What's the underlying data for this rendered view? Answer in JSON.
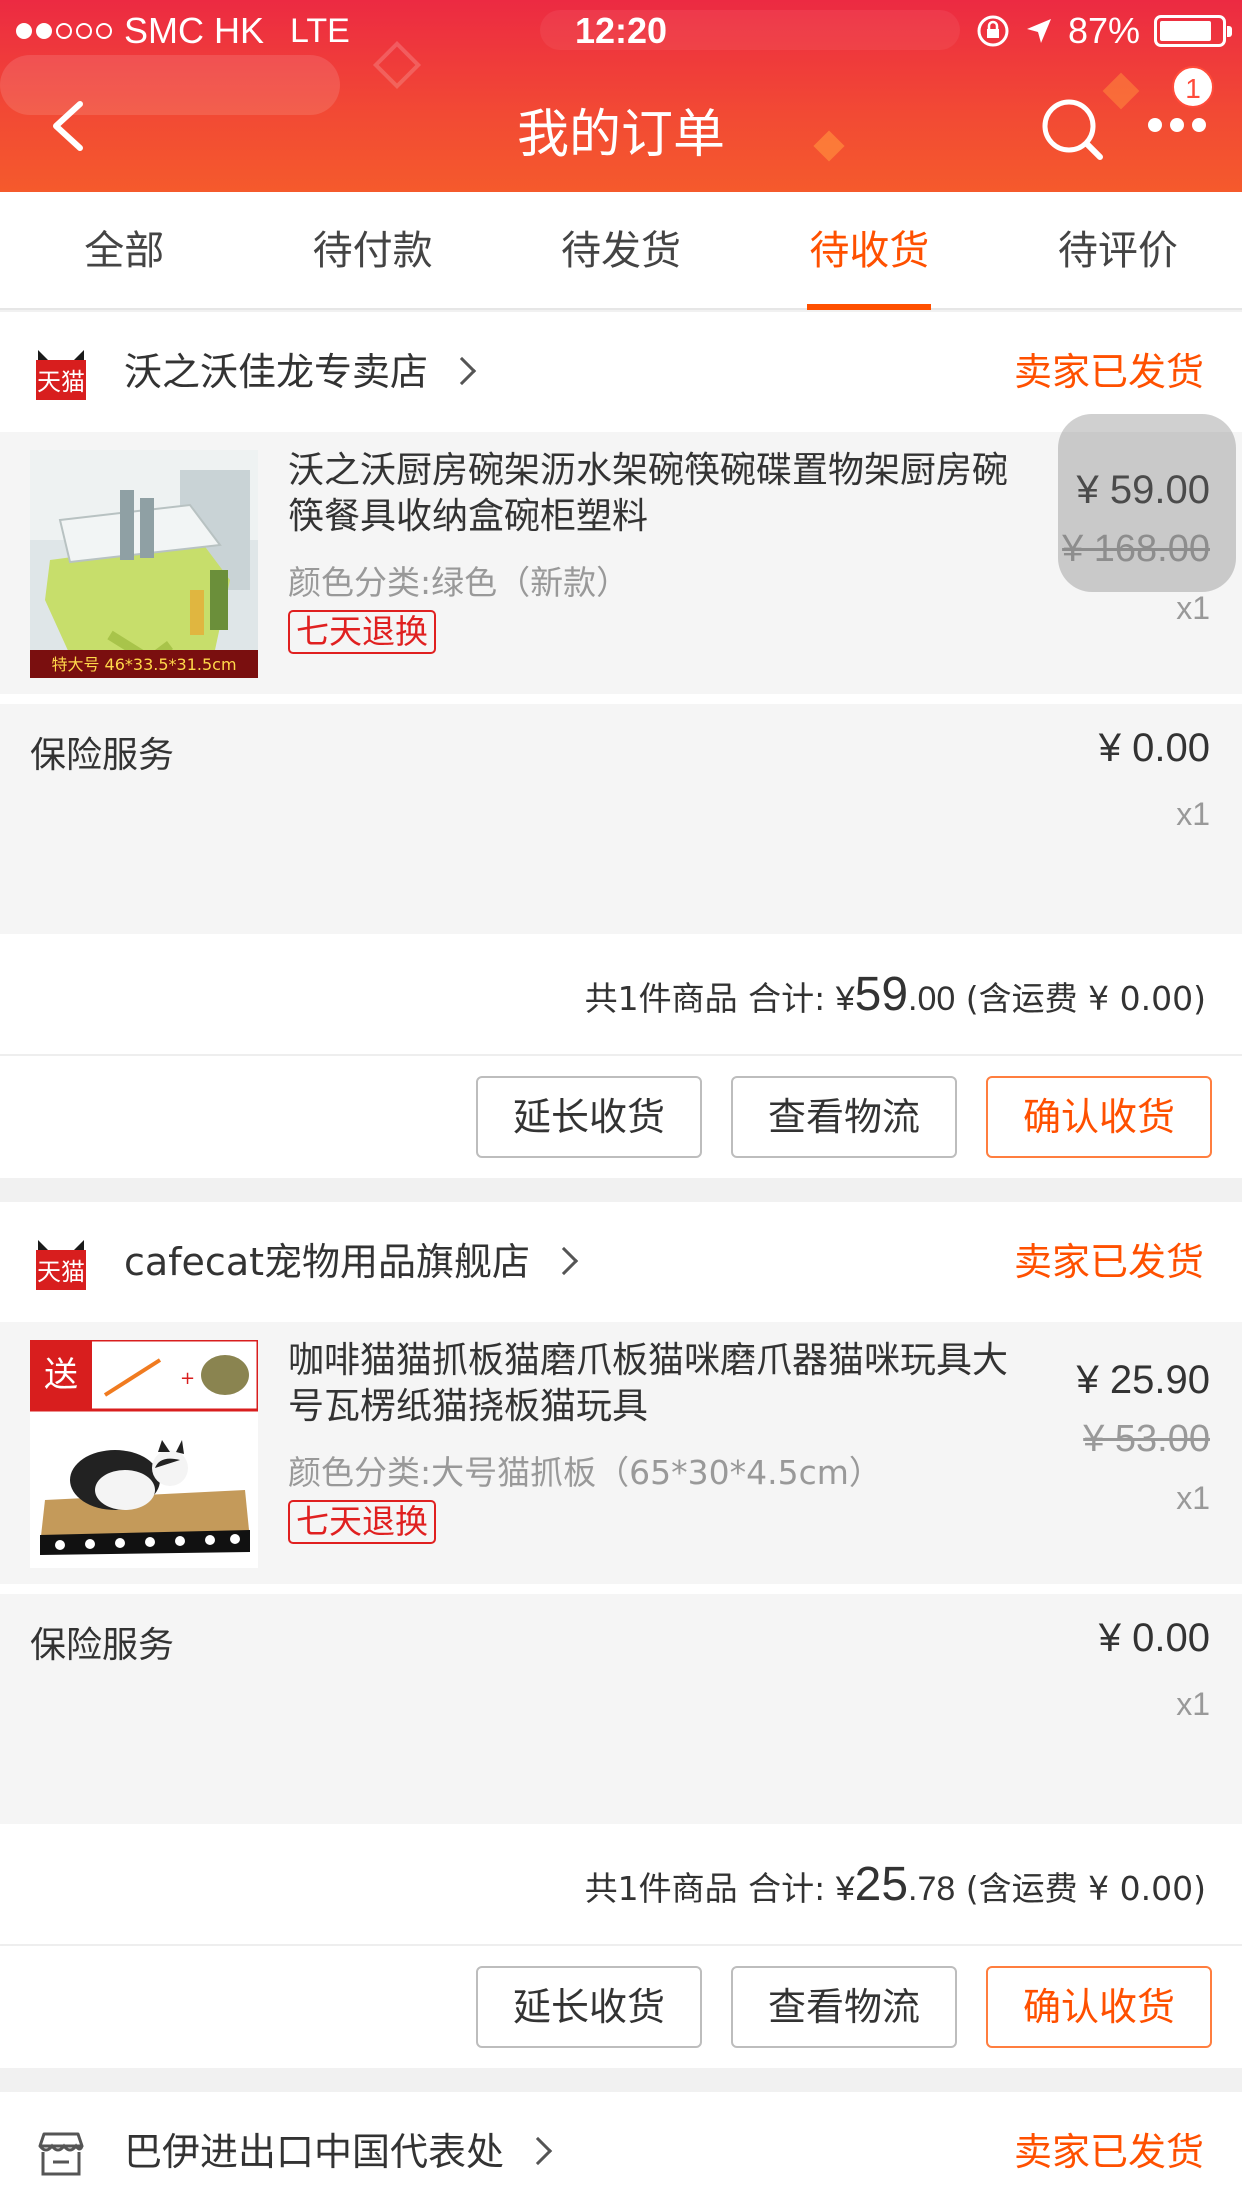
{
  "status_bar": {
    "carrier": "SMC HK",
    "network": "LTE",
    "time": "12:20",
    "battery": "87%"
  },
  "nav": {
    "title": "我的订单",
    "badge": "1"
  },
  "tabs": [
    "全部",
    "待付款",
    "待发货",
    "待收货",
    "待评价"
  ],
  "active_tab": "待收货",
  "orders": [
    {
      "shop": "沃之沃佳龙专卖店",
      "status": "卖家已发货",
      "item": {
        "title": "沃之沃厨房碗架沥水架碗筷碗碟置物架厨房碗筷餐具收纳盒碗柜塑料",
        "sku": "颜色分类:绿色（新款）",
        "tag": "七天退换",
        "price": "¥ 59.00",
        "original_price": "¥ 168.00",
        "qty": "x1",
        "thumb_caption": "特大号 46*33.5*31.5cm"
      },
      "insurance": {
        "name": "保险服务",
        "price": "¥ 0.00",
        "qty": "x1"
      },
      "summary": {
        "count": "共1件商品 合计:",
        "currency": "¥",
        "int": "59",
        "dec": ".00",
        "shipping": "(含运费 ¥ 0.00)"
      },
      "buttons": [
        "延长收货",
        "查看物流",
        "确认收货"
      ]
    },
    {
      "shop": "cafecat宠物用品旗舰店",
      "status": "卖家已发货",
      "item": {
        "title": "咖啡猫猫抓板猫磨爪板猫咪磨爪器猫咪玩具大号瓦楞纸猫挠板猫玩具",
        "sku": "颜色分类:大号猫抓板（65*30*4.5cm）",
        "tag": "七天退换",
        "price": "¥ 25.90",
        "original_price": "¥ 53.00",
        "qty": "x1",
        "thumb_badge": "送"
      },
      "insurance": {
        "name": "保险服务",
        "price": "¥ 0.00",
        "qty": "x1"
      },
      "summary": {
        "count": "共1件商品 合计:",
        "currency": "¥",
        "int": "25",
        "dec": ".78",
        "shipping": "(含运费 ¥ 0.00)"
      },
      "buttons": [
        "延长收货",
        "查看物流",
        "确认收货"
      ]
    },
    {
      "shop": "巴伊进出口中国代表处",
      "status": "卖家已发货"
    }
  ],
  "tmall_logo_text": "天猫",
  "colors": {
    "accent": "#ff5000",
    "header_top": "#ec2a42",
    "header_bottom": "#f55a2c",
    "tag_red": "#e02020"
  }
}
